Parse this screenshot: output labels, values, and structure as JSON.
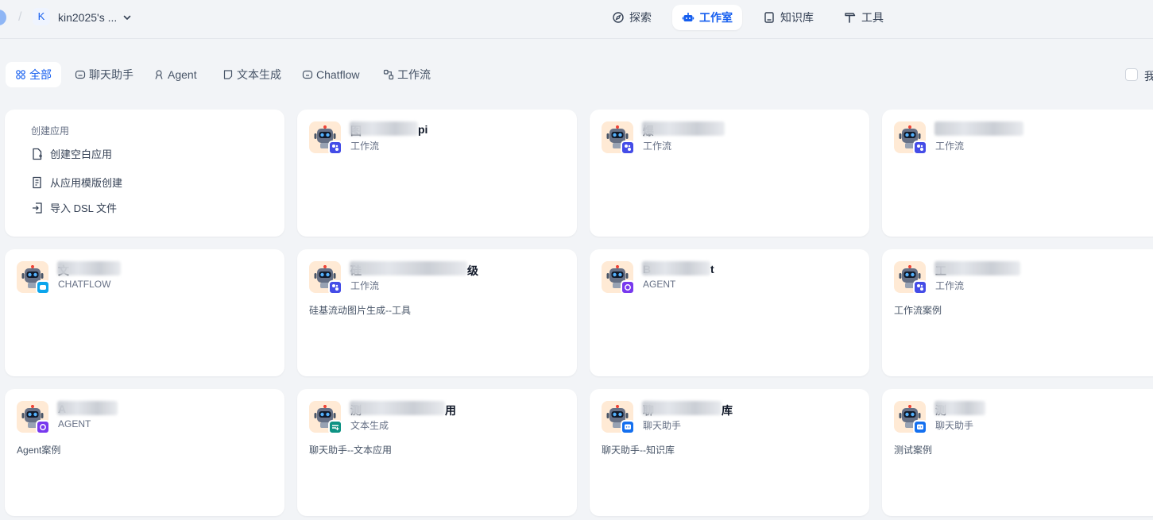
{
  "header": {
    "workspace_initial": "K",
    "workspace_name": "kin2025's ...",
    "nav": [
      {
        "label": "探索",
        "icon": "compass-icon",
        "active": false
      },
      {
        "label": "工作室",
        "icon": "robot-icon",
        "active": true
      },
      {
        "label": "知识库",
        "icon": "book-icon",
        "active": false
      },
      {
        "label": "工具",
        "icon": "hammer-icon",
        "active": false
      }
    ]
  },
  "filters": {
    "tabs": [
      {
        "label": "全部",
        "icon": "grid-icon",
        "active": true
      },
      {
        "label": "聊天助手",
        "icon": "chat-icon",
        "active": false
      },
      {
        "label": "Agent",
        "icon": "agent-icon",
        "active": false
      },
      {
        "label": "文本生成",
        "icon": "document-icon",
        "active": false
      },
      {
        "label": "Chatflow",
        "icon": "chatflow-icon",
        "active": false
      },
      {
        "label": "工作流",
        "icon": "workflow-icon",
        "active": false
      }
    ],
    "mine_label": "我"
  },
  "create": {
    "title": "创建应用",
    "items": [
      {
        "label": "创建空白应用",
        "icon": "file-plus-icon"
      },
      {
        "label": "从应用模版创建",
        "icon": "template-icon"
      },
      {
        "label": "导入 DSL 文件",
        "icon": "import-icon"
      }
    ]
  },
  "colors": {
    "accent": "#155eef",
    "workflow_badge": "#444ce7",
    "chatflow_badge": "#0ba5ec",
    "agent_badge": "#7839ee",
    "completion_badge": "#0e9384",
    "chat_badge": "#1570ef",
    "icon_bg": "#ffead5"
  },
  "apps": [
    {
      "name": "图",
      "suffix": "pi",
      "type": "工作流",
      "badge": "workflow",
      "desc": ""
    },
    {
      "name": "爆",
      "suffix": "",
      "type": "工作流",
      "badge": "workflow",
      "desc": ""
    },
    {
      "name": "",
      "suffix": "",
      "type": "工作流",
      "badge": "workflow",
      "desc": ""
    },
    {
      "name": "文",
      "suffix": "",
      "type": "CHATFLOW",
      "badge": "chatflow",
      "desc": ""
    },
    {
      "name": "硅",
      "suffix": "级",
      "type": "工作流",
      "badge": "workflow",
      "desc": "硅基流动图片生成--工具"
    },
    {
      "name": "B",
      "suffix": "t",
      "type": "AGENT",
      "badge": "agent",
      "desc": ""
    },
    {
      "name": "工",
      "suffix": "",
      "type": "工作流",
      "badge": "workflow",
      "desc": "工作流案例"
    },
    {
      "name": "A",
      "suffix": "",
      "type": "AGENT",
      "badge": "agent",
      "desc": "Agent案例"
    },
    {
      "name": "测",
      "suffix": "用",
      "type": "文本生成",
      "badge": "completion",
      "desc": "聊天助手--文本应用"
    },
    {
      "name": "聊",
      "suffix": "库",
      "type": "聊天助手",
      "badge": "chat",
      "desc": "聊天助手--知识库"
    },
    {
      "name": "测",
      "suffix": "",
      "type": "聊天助手",
      "badge": "chat",
      "desc": "测试案例"
    }
  ]
}
